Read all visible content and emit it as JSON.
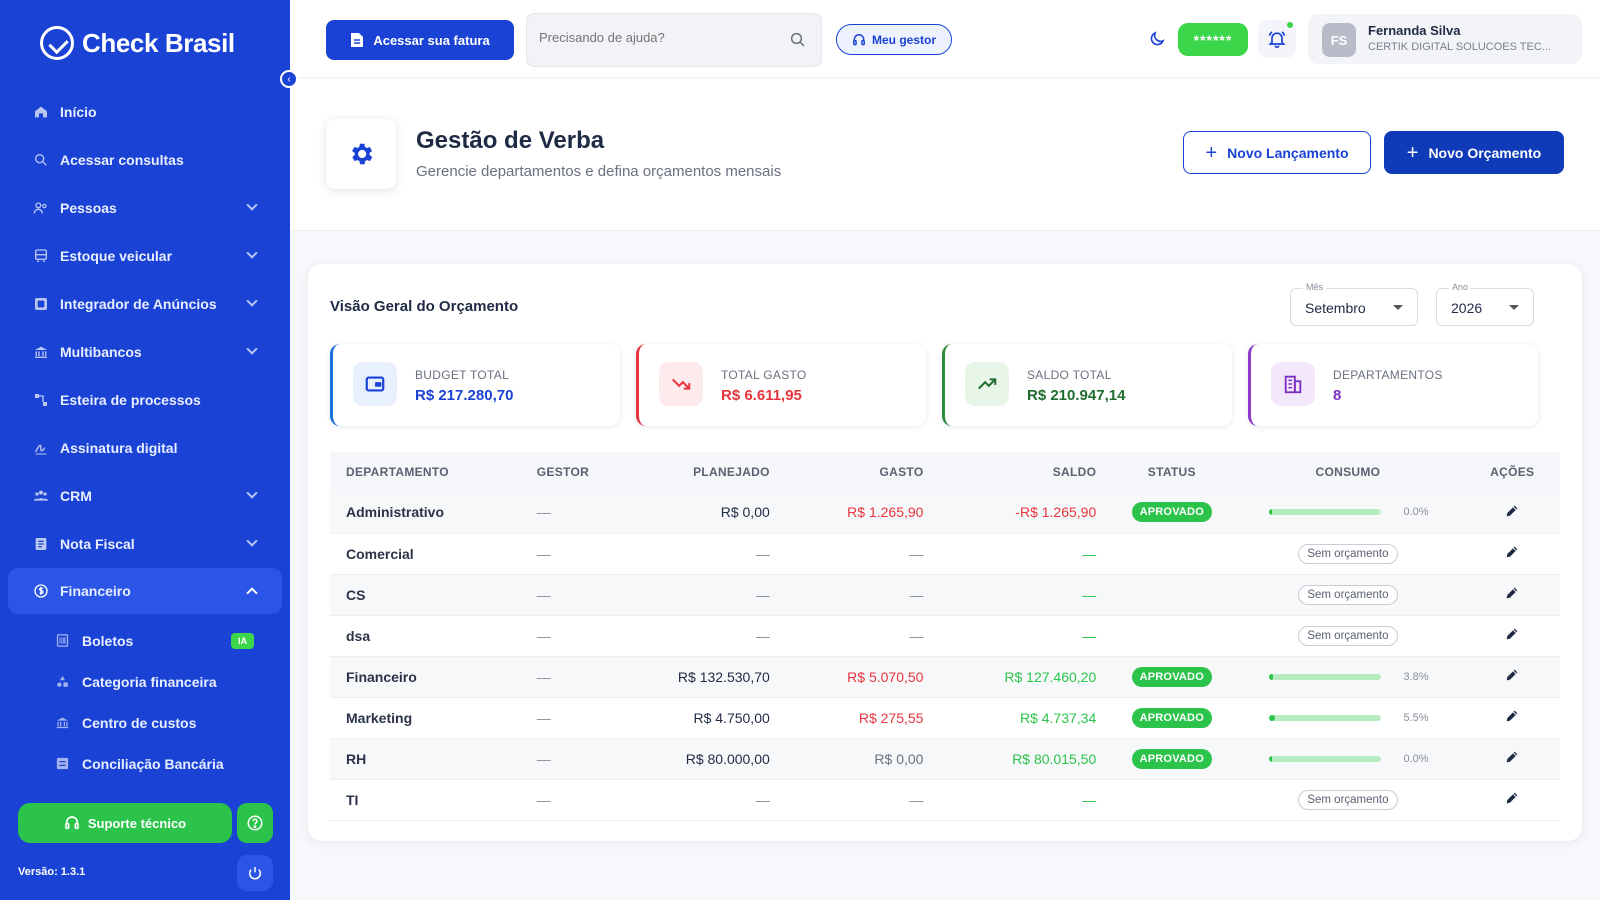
{
  "brand": {
    "name": "Check Brasil"
  },
  "sidebar": {
    "items": [
      {
        "label": "Início",
        "icon": "home-icon",
        "expandable": false
      },
      {
        "label": "Acessar consultas",
        "icon": "search-icon",
        "expandable": false
      },
      {
        "label": "Pessoas",
        "icon": "people-icon",
        "expandable": true
      },
      {
        "label": "Estoque veicular",
        "icon": "car-icon",
        "expandable": true
      },
      {
        "label": "Integrador de Anúncios",
        "icon": "ads-icon",
        "expandable": true
      },
      {
        "label": "Multibancos",
        "icon": "bank-icon",
        "expandable": true
      },
      {
        "label": "Esteira de processos",
        "icon": "workflow-icon",
        "expandable": false
      },
      {
        "label": "Assinatura digital",
        "icon": "signature-icon",
        "expandable": false
      },
      {
        "label": "CRM",
        "icon": "crm-icon",
        "expandable": true
      },
      {
        "label": "Nota Fiscal",
        "icon": "invoice-icon",
        "expandable": true
      },
      {
        "label": "Financeiro",
        "icon": "finance-icon",
        "expandable": true,
        "active": true
      }
    ],
    "subitems": [
      {
        "label": "Boletos",
        "icon": "barcode-icon",
        "badge": "IA"
      },
      {
        "label": "Categoria financeira",
        "icon": "category-icon"
      },
      {
        "label": "Centro de custos",
        "icon": "bank-icon"
      },
      {
        "label": "Conciliação Bancária",
        "icon": "reconcile-icon"
      }
    ],
    "support_label": "Suporte técnico",
    "version": "Versão: 1.3.1"
  },
  "topbar": {
    "invoice_button": "Acessar sua fatura",
    "search_placeholder": "Precisando de ajuda?",
    "manager_button": "Meu gestor",
    "masked_value": "******",
    "user": {
      "initials": "FS",
      "name": "Fernanda Silva",
      "company": "CERTIK DIGITAL SOLUCOES TEC..."
    }
  },
  "header": {
    "title": "Gestão de Verba",
    "subtitle": "Gerencie departamentos e defina orçamentos mensais",
    "new_entry_button": "Novo Lançamento",
    "new_budget_button": "Novo Orçamento"
  },
  "overview": {
    "title": "Visão Geral do Orçamento",
    "month": {
      "label": "Mês",
      "value": "Setembro"
    },
    "year": {
      "label": "Ano",
      "value": "2026"
    },
    "stats": [
      {
        "label": "BUDGET TOTAL",
        "value": "R$ 217.280,70",
        "color": "#1a43d6",
        "bg": "#e8f0fe",
        "border": "#1a6fd6",
        "icon": "wallet-icon"
      },
      {
        "label": "TOTAL GASTO",
        "value": "R$ 6.611,95",
        "color": "#e8353d",
        "bg": "#fdeaec",
        "border": "#e8353d",
        "icon": "trending-down-icon"
      },
      {
        "label": "SALDO TOTAL",
        "value": "R$ 210.947,14",
        "color": "#1f6d2e",
        "bg": "#e8f6ea",
        "border": "#2e8b3c",
        "icon": "trending-up-icon"
      },
      {
        "label": "DEPARTAMENTOS",
        "value": "8",
        "color": "#7b2fbf",
        "bg": "#f3e8fb",
        "border": "#8e3ac9",
        "icon": "building-icon"
      }
    ]
  },
  "table": {
    "headers": [
      "DEPARTAMENTO",
      "GESTOR",
      "PLANEJADO",
      "GASTO",
      "SALDO",
      "STATUS",
      "CONSUMO",
      "AÇÕES"
    ],
    "no_budget_label": "Sem orçamento",
    "rows": [
      {
        "dept": "Administrativo",
        "gestor": "—",
        "planejado": "R$ 0,00",
        "gasto": "R$ 1.265,90",
        "gasto_tone": "red",
        "saldo": "-R$ 1.265,90",
        "saldo_tone": "red",
        "status": "APROVADO",
        "consumo": 0.0,
        "consumo_label": "0.0%"
      },
      {
        "dept": "Comercial",
        "gestor": "—",
        "planejado": "—",
        "gasto": "—",
        "gasto_tone": "dash",
        "saldo": "—",
        "saldo_tone": "green",
        "status": "",
        "consumo": null,
        "consumo_label": ""
      },
      {
        "dept": "CS",
        "gestor": "—",
        "planejado": "—",
        "gasto": "—",
        "gasto_tone": "dash",
        "saldo": "—",
        "saldo_tone": "green",
        "status": "",
        "consumo": null,
        "consumo_label": ""
      },
      {
        "dept": "dsa",
        "gestor": "—",
        "planejado": "—",
        "gasto": "—",
        "gasto_tone": "dash",
        "saldo": "—",
        "saldo_tone": "green",
        "status": "",
        "consumo": null,
        "consumo_label": ""
      },
      {
        "dept": "Financeiro",
        "gestor": "—",
        "planejado": "R$ 132.530,70",
        "gasto": "R$ 5.070,50",
        "gasto_tone": "red",
        "saldo": "R$ 127.460,20",
        "saldo_tone": "green",
        "status": "APROVADO",
        "consumo": 3.8,
        "consumo_label": "3.8%"
      },
      {
        "dept": "Marketing",
        "gestor": "—",
        "planejado": "R$ 4.750,00",
        "gasto": "R$ 275,55",
        "gasto_tone": "red",
        "saldo": "R$ 4.737,34",
        "saldo_tone": "green",
        "status": "APROVADO",
        "consumo": 5.5,
        "consumo_label": "5.5%"
      },
      {
        "dept": "RH",
        "gestor": "—",
        "planejado": "R$ 80.000,00",
        "gasto": "R$ 0,00",
        "gasto_tone": "gray",
        "saldo": "R$ 80.015,50",
        "saldo_tone": "green",
        "status": "APROVADO",
        "consumo": 0.0,
        "consumo_label": "0.0%"
      },
      {
        "dept": "TI",
        "gestor": "—",
        "planejado": "—",
        "gasto": "—",
        "gasto_tone": "dash",
        "saldo": "—",
        "saldo_tone": "green",
        "status": "",
        "consumo": null,
        "consumo_label": ""
      }
    ]
  }
}
